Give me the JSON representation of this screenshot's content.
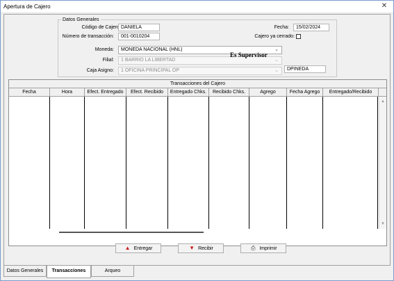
{
  "window": {
    "title": "Apertura de Cajero",
    "close_glyph": "✕"
  },
  "datos_generales": {
    "legend": "Datos Generales",
    "codigo_label": "Código de Cajero:",
    "codigo_value": "DANIELA",
    "fecha_label": "Fecha:",
    "fecha_value": "15/02/2024",
    "numero_label": "Número de transacción:",
    "numero_value": "001-0010204",
    "cajero_cerrado_label": "Cajero ya cerrado:",
    "moneda_label": "Moneda:",
    "moneda_value": "MONEDA NACIONAL (HNL)",
    "filial_label": "Filial:",
    "filial_value": "1  BARRIO LA LIBERTAD",
    "caja_label": "Caja Asigno:",
    "caja_value": "1  OFICINA  PRINCIPAL OP",
    "supervisor_label": "Es Supervisor",
    "supervisor_value": "DPINEDA"
  },
  "grid": {
    "caption": "Transacciones del Cajero",
    "columns": [
      "Fecha",
      "Hora",
      "Efect. Entregado",
      "Efect. Recibido",
      "Entregado Chks.",
      "Recibido Chks.",
      "Agrego",
      "Fecha Agrego",
      "Entregado/Recibido"
    ],
    "rows": []
  },
  "buttons": {
    "entregar": "Entregar",
    "recibir": "Recibir",
    "imprimir": "Imprimir"
  },
  "icons": {
    "entregar": "up-arrow-icon",
    "recibir": "down-arrow-icon",
    "imprimir": "printer-icon"
  },
  "tabs": [
    {
      "label": "Datos Generales",
      "active": false
    },
    {
      "label": "Transacciones",
      "active": true
    },
    {
      "label": "Arqueo",
      "active": false
    }
  ]
}
